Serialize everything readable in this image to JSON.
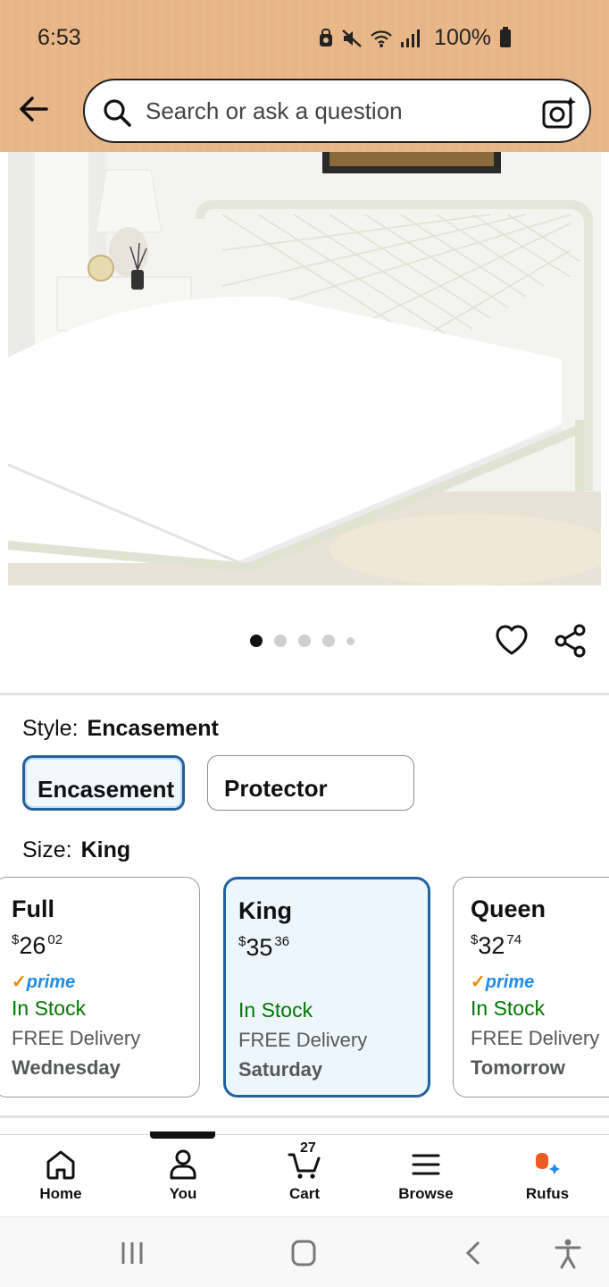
{
  "status_bar": {
    "time": "6:53",
    "battery": "100%"
  },
  "header": {
    "search_placeholder": "Search or ask a question"
  },
  "carousel": {
    "count": 5,
    "active_index": 0
  },
  "style": {
    "label": "Style:",
    "selected": "Encasement",
    "options": [
      "Encasement",
      "Protector"
    ]
  },
  "size": {
    "label": "Size:",
    "selected": "King",
    "options": [
      {
        "name": "Full",
        "currency": "$",
        "dollars": "26",
        "cents": "02",
        "prime": true,
        "stock": "In Stock",
        "delivery": "FREE Delivery",
        "day": "Wednesday"
      },
      {
        "name": "King",
        "currency": "$",
        "dollars": "35",
        "cents": "36",
        "prime": false,
        "stock": "In Stock",
        "delivery": "FREE Delivery",
        "day": "Saturday"
      },
      {
        "name": "Queen",
        "currency": "$",
        "dollars": "32",
        "cents": "74",
        "prime": true,
        "stock": "In Stock",
        "delivery": "FREE Delivery",
        "day": "Tomorrow"
      }
    ],
    "prime_label": "prime"
  },
  "bottom_nav": {
    "items": [
      {
        "label": "Home"
      },
      {
        "label": "You"
      },
      {
        "label": "Cart",
        "badge": "27"
      },
      {
        "label": "Browse"
      },
      {
        "label": "Rufus"
      }
    ]
  },
  "colors": {
    "header_bg": "#eab98a",
    "selected_border": "#2162a1",
    "in_stock": "#007600",
    "prime_blue": "#1f8ce6",
    "prime_check": "#f08804",
    "rufus_orange": "#f05a22",
    "rufus_blue": "#1f8ce6"
  }
}
